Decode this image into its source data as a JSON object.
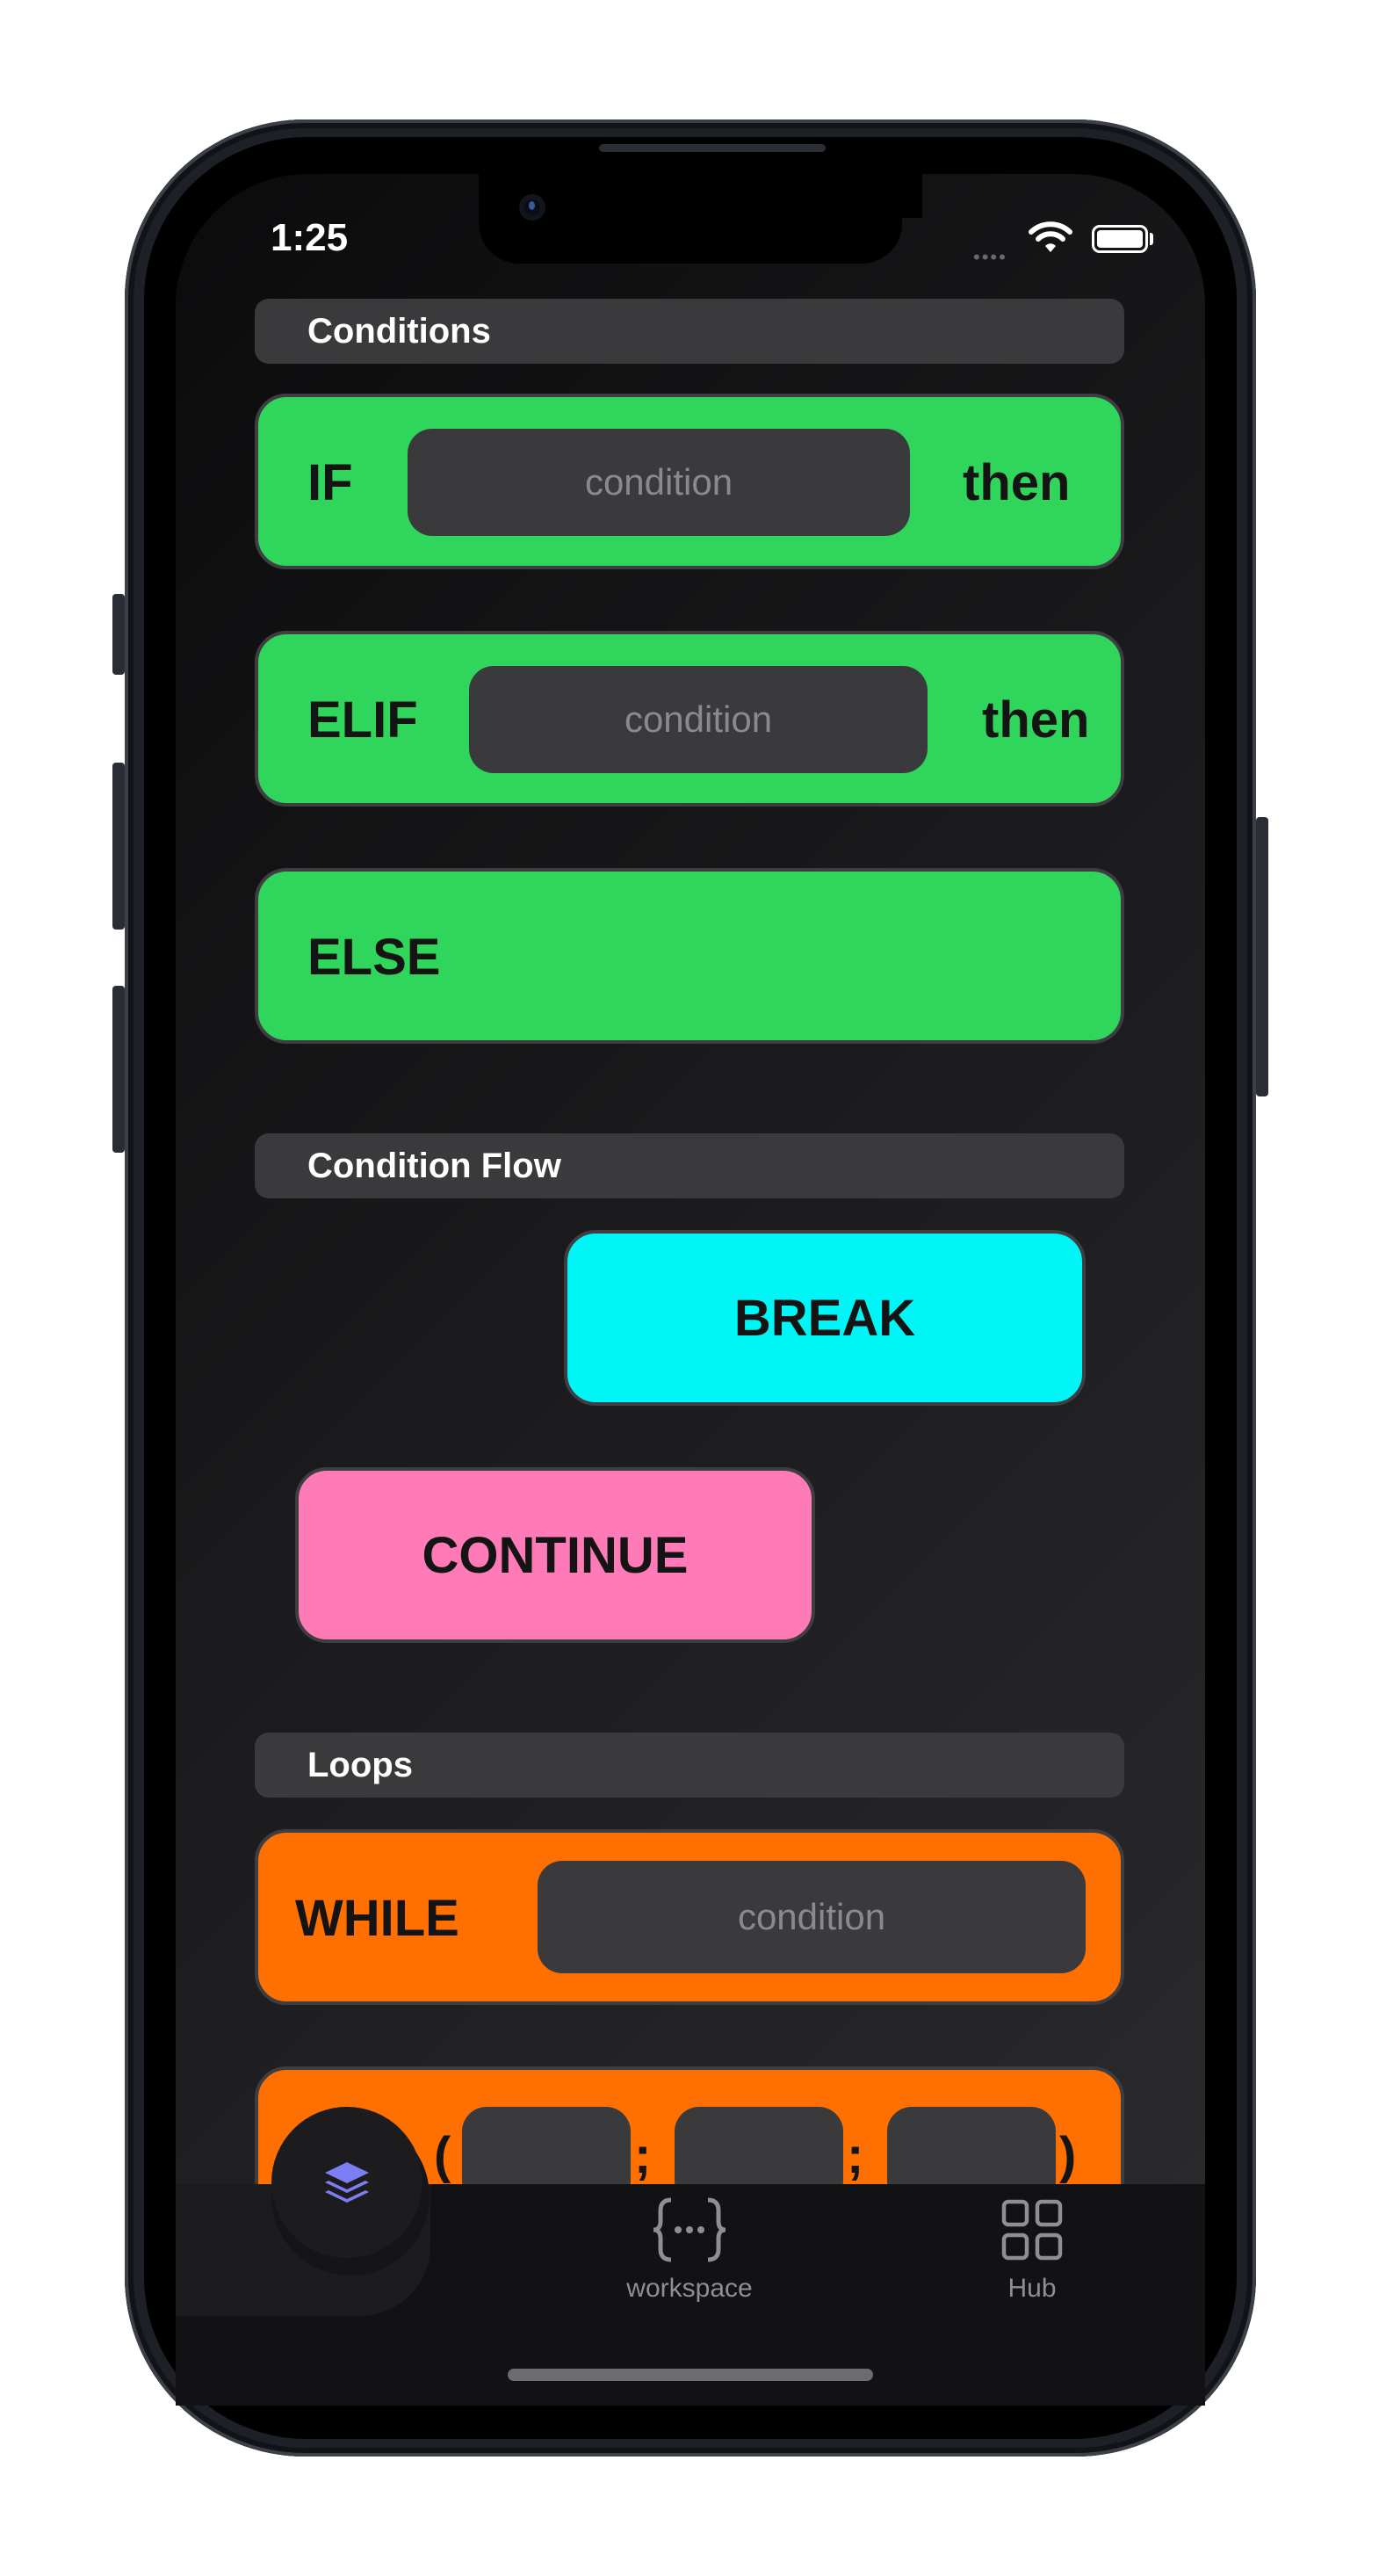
{
  "status": {
    "time": "1:25",
    "signal_dots": "••••"
  },
  "sections": {
    "conditions": "Conditions",
    "condition_flow": "Condition Flow",
    "loops": "Loops"
  },
  "blocks": {
    "if": {
      "keyword": "IF",
      "placeholder": "condition",
      "suffix": "then"
    },
    "elif": {
      "keyword": "ELIF",
      "placeholder": "condition",
      "suffix": "then"
    },
    "else": {
      "keyword": "ELSE"
    },
    "break": {
      "keyword": "BREAK"
    },
    "continue": {
      "keyword": "CONTINUE"
    },
    "while": {
      "keyword": "WHILE",
      "placeholder": "condition"
    },
    "for": {
      "open_paren": "(",
      "sep1": ";",
      "sep2": ";",
      "close_paren": ")"
    }
  },
  "colors": {
    "condition_block": "#30d65b",
    "break_block": "#00f6f6",
    "continue_block": "#ff7bb7",
    "loop_block": "#ff7000",
    "active_tab_icon": "#7b7ef5"
  },
  "tabbar": {
    "items": [
      {
        "icon": "layers-icon",
        "label": ""
      },
      {
        "icon": "braces-icon",
        "label": "workspace"
      },
      {
        "icon": "grid-icon",
        "label": "Hub"
      }
    ]
  }
}
